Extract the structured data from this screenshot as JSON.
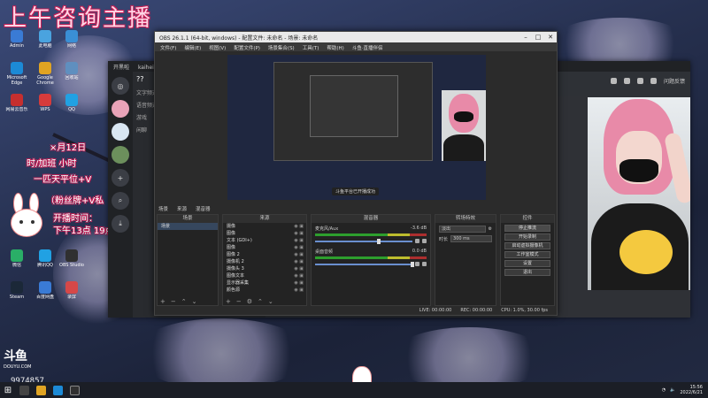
{
  "overlay": {
    "title": "上午咨询主播",
    "lines": [
      "×月12日",
      "时/加班 小时",
      "一匹天平位+V",
      "（粉丝牌+V私",
      "开播时间：",
      "下午13点 19点"
    ]
  },
  "desktop_icons": [
    {
      "label": "Admin",
      "color": "#3a7bd5"
    },
    {
      "label": "此电脑",
      "color": "#4aa3df"
    },
    {
      "label": "网络",
      "color": "#3a8fd5"
    },
    {
      "label": "Microsoft Edge",
      "color": "#1c8ad6"
    },
    {
      "label": "Google Chrome",
      "color": "#e0a423"
    },
    {
      "label": "回收站",
      "color": "#5f8fbf"
    },
    {
      "label": "网易云音乐",
      "color": "#c62f2f"
    },
    {
      "label": "WPS",
      "color": "#d63b3b"
    },
    {
      "label": "QQ",
      "color": "#21a1e3"
    },
    {
      "label": "微信",
      "color": "#2aae67"
    },
    {
      "label": "腾讯QQ",
      "color": "#21a1e3"
    },
    {
      "label": "OBS Studio",
      "color": "#303030"
    },
    {
      "label": "Steam",
      "color": "#1b2838"
    },
    {
      "label": "百度网盘",
      "color": "#3a7bd5"
    },
    {
      "label": "录屏",
      "color": "#d64848"
    }
  ],
  "kaiheila": {
    "title_left": "开黑啦",
    "url": "kaiheila.cn",
    "channel_header": "??",
    "channels": [
      "文字频道",
      "语音频道",
      "游戏",
      "闲聊"
    ],
    "top_right": "问题反馈"
  },
  "obs": {
    "title": "OBS 26.1.1 (64-bit, windows) - 配置文件: 未命名 - 场景: 未命名",
    "menu": [
      "文件(F)",
      "编辑(E)",
      "视图(V)",
      "配置文件(P)",
      "场景集合(S)",
      "工具(T)",
      "帮助(H)",
      "斗鱼·直播伴侣"
    ],
    "preview_tip": "斗鱼平台已开播成功",
    "scene_tabs": [
      "场景",
      "来源",
      "混音器"
    ],
    "scene_dock_header": "场景",
    "scenes": [
      "场景"
    ],
    "sources_dock_header": "来源",
    "sources": [
      "摄像",
      "图像",
      "文本 (GDI+)",
      "图像",
      "图像 2",
      "摄像机 2",
      "摄像头 3",
      "图像文本",
      "显示器采集",
      "颜色源"
    ],
    "mixer_header": "混音器",
    "mixer": [
      {
        "name": "麦克风/Aux",
        "db": "-3.6 dB"
      },
      {
        "name": "桌面音频",
        "db": "0.0 dB"
      }
    ],
    "transition_header": "转场特效",
    "transition": {
      "type": "淡出",
      "duration_label": "时长",
      "duration": "300 ms"
    },
    "controls_header": "控件",
    "controls": [
      "停止推流",
      "开始录制",
      "启动虚拟摄像机",
      "工作室模式",
      "设置",
      "退出"
    ],
    "status": {
      "live": "LIVE: 00:00:00",
      "rec": "REC: 00:00:00",
      "cpu": "CPU: 1.0%, 30.00 fps"
    }
  },
  "stream": {
    "platform": "DOUYU.COM",
    "room_id": "9974857"
  },
  "taskbar": {
    "start": "⊞",
    "time": "15:56",
    "date": "2022/6/21"
  }
}
